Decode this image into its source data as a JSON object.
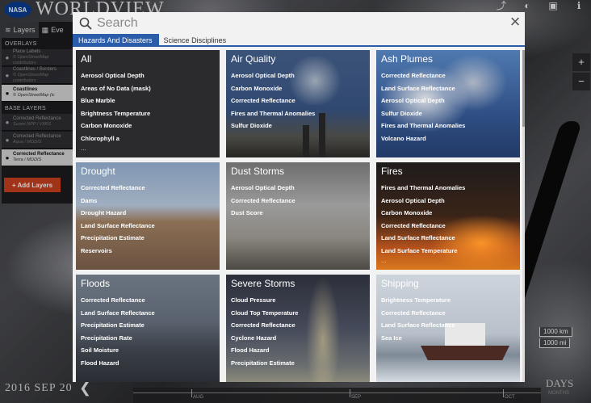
{
  "app": {
    "logo": "NASA",
    "title": "WORLDVIEW"
  },
  "top_icons": [
    "share-icon",
    "globe-icon",
    "camera-icon",
    "info-icon"
  ],
  "sidebar": {
    "tabs": [
      {
        "label": "Layers",
        "icon": "layers-icon"
      },
      {
        "label": "Eve",
        "icon": "calendar-icon"
      }
    ],
    "overlays_title": "OVERLAYS",
    "overlays": [
      {
        "name": "Place Labels",
        "source": "© OpenStreetMap contributors"
      },
      {
        "name": "Coastlines / Borders",
        "source": "© OpenStreetMap contributors"
      },
      {
        "name": "Coastlines",
        "source": "© OpenStreetMap (ic"
      }
    ],
    "base_title": "BASE LAYERS",
    "base_layers": [
      {
        "name": "Corrected Reflectance",
        "source": "Suomi NPP / VIIRS"
      },
      {
        "name": "Corrected Reflectance",
        "source": "Aqua / MODIS"
      },
      {
        "name": "Corrected Reflectance",
        "source": "Terra / MODIS"
      }
    ],
    "add_layers": "+ Add Layers"
  },
  "zoom": {
    "in": "+",
    "out": "−"
  },
  "scale": {
    "km": "1000 km",
    "mi": "1000 mi"
  },
  "timeline": {
    "date": "2016 SEP 20",
    "months": [
      "AUG",
      "SEP",
      "OCT"
    ],
    "days_label": "DAYS",
    "unit_label": "MONTHS"
  },
  "modal": {
    "search_placeholder": "Search",
    "close": "×",
    "tabs": [
      "Hazards And Disasters",
      "Science Disciplines"
    ],
    "categories": [
      {
        "title": "All",
        "items": [
          "Aerosol Optical Depth",
          "Areas of No Data (mask)",
          "Blue Marble",
          "Brightness Temperature",
          "Carbon Monoxide",
          "Chlorophyll a"
        ],
        "more": "..."
      },
      {
        "title": "Air Quality",
        "items": [
          "Aerosol Optical Depth",
          "Carbon Monoxide",
          "Corrected Reflectance",
          "Fires and Thermal Anomalies",
          "Sulfur Dioxide"
        ]
      },
      {
        "title": "Ash Plumes",
        "items": [
          "Corrected Reflectance",
          "Land Surface Reflectance",
          "Aerosol Optical Depth",
          "Sulfur Dioxide",
          "Fires and Thermal Anomalies",
          "Volcano Hazard"
        ]
      },
      {
        "title": "Drought",
        "items": [
          "Corrected Reflectance",
          "Dams",
          "Drought Hazard",
          "Land Surface Reflectance",
          "Precipitation Estimate",
          "Reservoirs"
        ]
      },
      {
        "title": "Dust Storms",
        "items": [
          "Aerosol Optical Depth",
          "Corrected Reflectance",
          "Dust Score"
        ]
      },
      {
        "title": "Fires",
        "items": [
          "Fires and Thermal Anomalies",
          "Aerosol Optical Depth",
          "Carbon Monoxide",
          "Corrected Reflectance",
          "Land Surface Reflectance",
          "Land Surface Temperature"
        ],
        "more": "..."
      },
      {
        "title": "Floods",
        "items": [
          "Corrected Reflectance",
          "Land Surface Reflectance",
          "Precipitation Estimate",
          "Precipitation Rate",
          "Soil Moisture",
          "Flood Hazard"
        ]
      },
      {
        "title": "Severe Storms",
        "items": [
          "Cloud Pressure",
          "Cloud Top Temperature",
          "Corrected Reflectance",
          "Cyclone Hazard",
          "Flood Hazard",
          "Precipitation Estimate"
        ]
      },
      {
        "title": "Shipping",
        "items": [
          "Brightness Temperature",
          "Corrected Reflectance",
          "Land Surface Reflectance",
          "Sea Ice"
        ]
      }
    ]
  }
}
